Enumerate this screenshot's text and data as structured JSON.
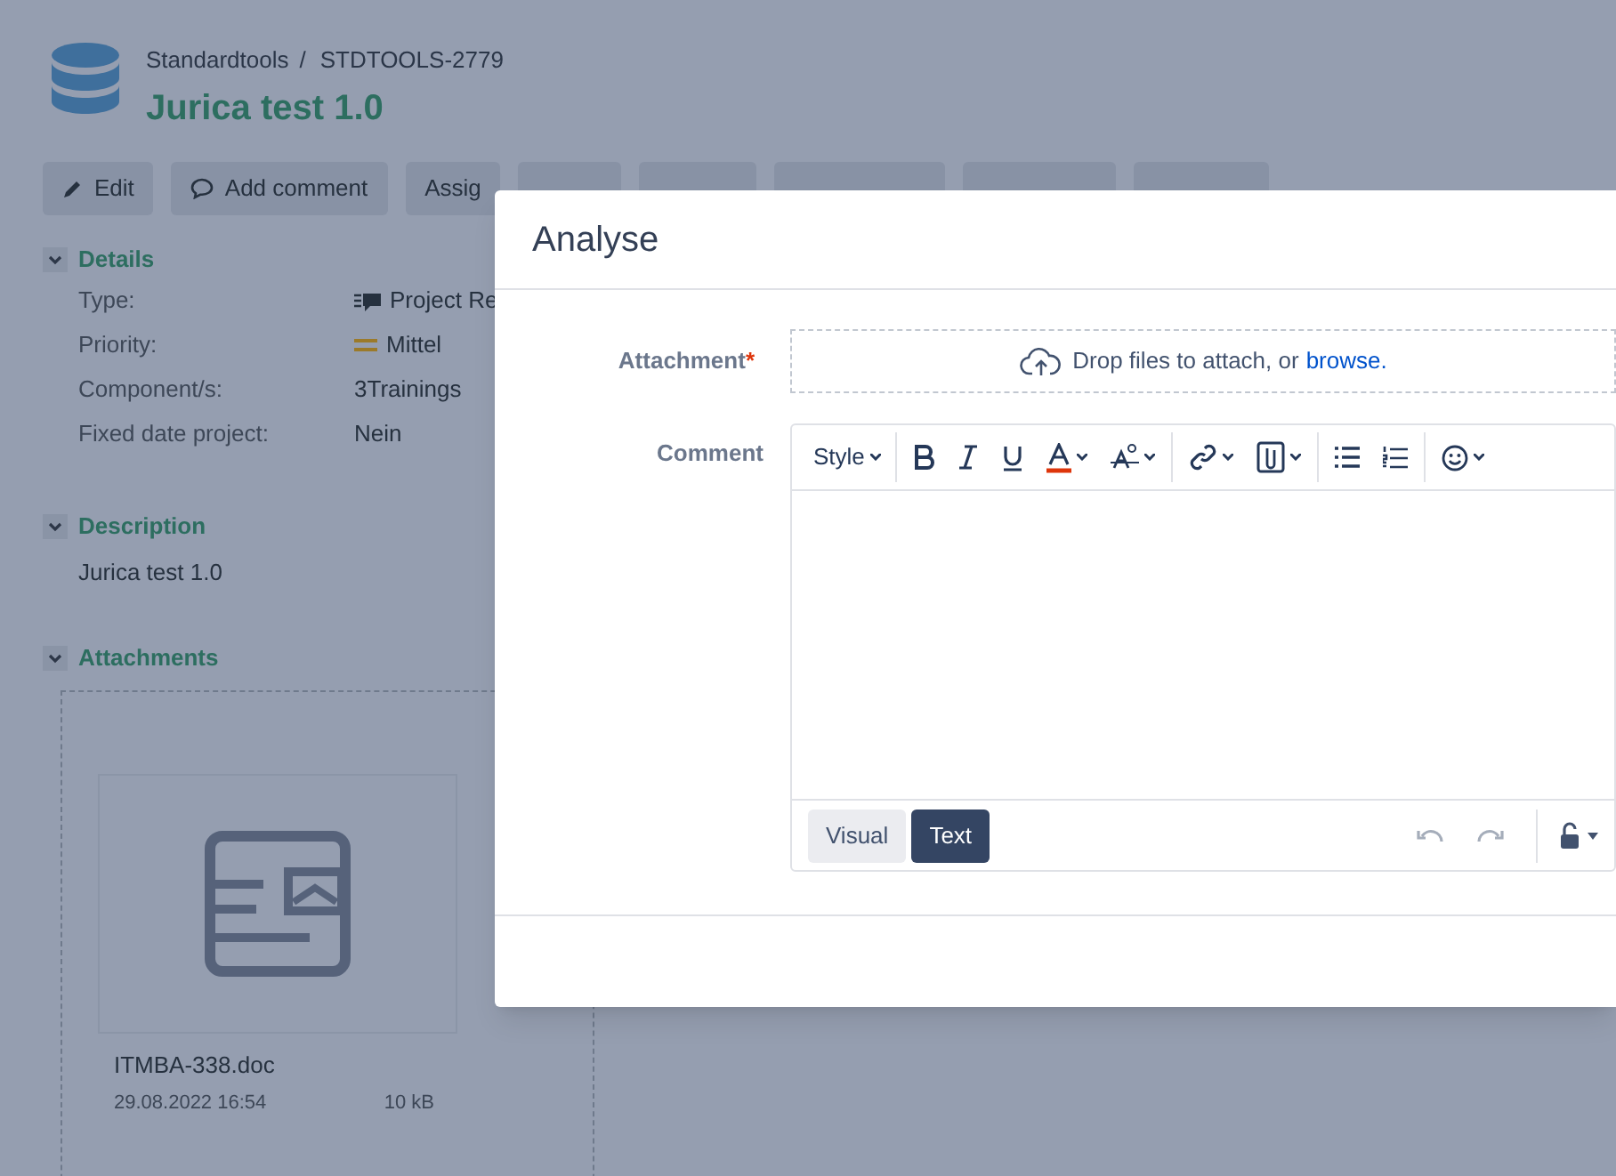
{
  "breadcrumb": {
    "project": "Standardtools",
    "separator": "/",
    "issue_key": "STDTOOLS-2779"
  },
  "title": "Jurica test 1.0",
  "toolbar": [
    {
      "label": "Edit",
      "kind": "edit"
    },
    {
      "label": "Add comment",
      "kind": "comment"
    },
    {
      "label": "Assig",
      "kind": "plain"
    }
  ],
  "sections": [
    {
      "title": "Details",
      "expanded": true,
      "kind": "fields",
      "fields": [
        {
          "label": "Type:",
          "value": "Project Re",
          "kind": "type"
        },
        {
          "label": "Priority:",
          "value": "Mittel",
          "kind": "priority"
        },
        {
          "label": "Component/s:",
          "value": "3Trainings",
          "kind": "plain"
        },
        {
          "label": "Fixed date project:",
          "value": "Nein",
          "kind": "plain"
        }
      ]
    },
    {
      "title": "Description",
      "expanded": true,
      "kind": "text",
      "text": "Jurica test 1.0"
    },
    {
      "title": "Attachments",
      "expanded": true,
      "kind": "attachments",
      "files": [
        {
          "name": "ITMBA-338.doc",
          "date": "29.08.2022 16:54",
          "size": "10 kB"
        }
      ]
    }
  ],
  "dialog": {
    "title": "Analyse",
    "attachment": {
      "label": "Attachment",
      "required": true,
      "mark": "*",
      "drop_text": "Drop files to attach, or",
      "link": "browse."
    },
    "comment": {
      "label": "Comment",
      "toolbar_groups": [
        [
          {
            "kind": "style",
            "label": "Style"
          }
        ],
        [
          {
            "kind": "bold"
          },
          {
            "kind": "italic"
          },
          {
            "kind": "underline"
          },
          {
            "kind": "color"
          },
          {
            "kind": "format"
          }
        ],
        [
          {
            "kind": "link"
          },
          {
            "kind": "attach"
          }
        ],
        [
          {
            "kind": "bullets"
          },
          {
            "kind": "numbered"
          }
        ],
        [
          {
            "kind": "emoji"
          }
        ]
      ],
      "modes": [
        {
          "label": "Visual",
          "selected": false
        },
        {
          "label": "Text",
          "selected": true
        }
      ],
      "undo_enabled": false,
      "redo_enabled": false
    }
  }
}
